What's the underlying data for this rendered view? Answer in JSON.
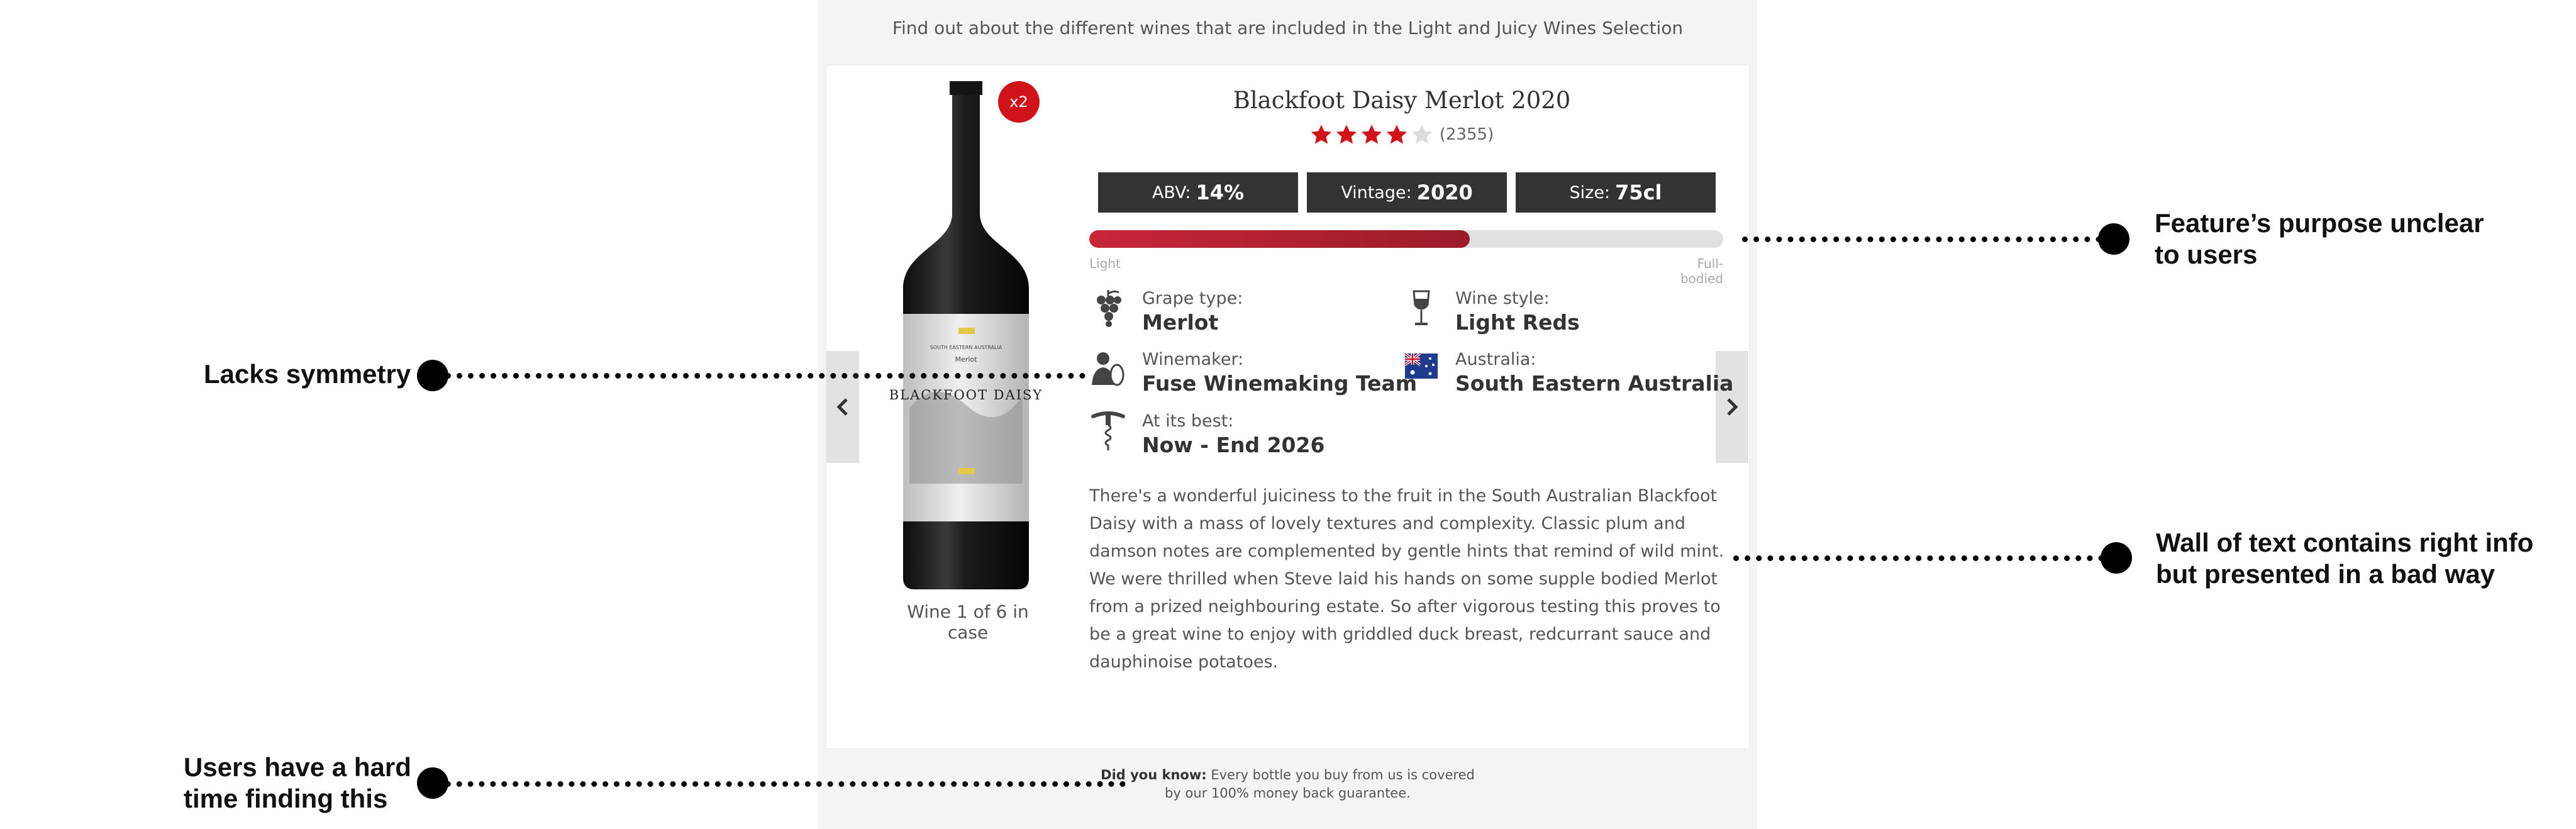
{
  "intro_text": "Find out about the different wines that are included in the Light and Juicy Wines Selection",
  "product": {
    "quantity_badge": "x2",
    "title": "Blackfoot Daisy Merlot 2020",
    "rating": 4,
    "rating_max": 5,
    "rating_count": "(2355)",
    "label_top": "SOUTH EASTERN AUSTRALIA",
    "label_variety": "Merlot",
    "label_brand": "BLACKFOOT DAISY",
    "chips": [
      {
        "key": "ABV:",
        "value": "14%"
      },
      {
        "key": "Vintage:",
        "value": "2020"
      },
      {
        "key": "Size:",
        "value": "75cl"
      }
    ],
    "body_scale": {
      "level": 0.6,
      "low_label": "Light",
      "high_label": "Full-bodied"
    },
    "attributes": {
      "grape": {
        "label": "Grape type:",
        "value": "Merlot",
        "icon": "grapes-icon"
      },
      "style": {
        "label": "Wine style:",
        "value": "Light Reds",
        "icon": "wine-glass-icon"
      },
      "winemaker": {
        "label": "Winemaker:",
        "value": "Fuse Winemaking Team",
        "icon": "winemaker-icon"
      },
      "region": {
        "label": "Australia:",
        "value": "South Eastern Australia",
        "icon": "australia-flag-icon"
      },
      "best": {
        "label": "At its best:",
        "value": "Now - End 2026",
        "icon": "corkscrew-icon"
      }
    },
    "description": "There's a wonderful juiciness to the fruit in the South Australian Blackfoot Daisy with a mass of lovely textures and complexity. Classic plum and damson notes are complemented by gentle hints that remind of wild mint. We were thrilled when Steve laid his hands on some supple bodied Merlot from a prized neighbouring estate. So after vigorous testing this proves to be a great wine to enjoy with griddled duck breast, redcurrant sauce and dauphinoise potatoes.",
    "case_position": "Wine 1 of 6 in case"
  },
  "footer": {
    "label": "Did you know:",
    "line1": "Every bottle you buy from us is covered",
    "line2": "by our 100% money back guarantee."
  },
  "annotations": [
    {
      "id": "feature",
      "line1": "Feature’s purpose unclear",
      "line2": "to users"
    },
    {
      "id": "symmetry",
      "line1": "Lacks symmetry",
      "line2": ""
    },
    {
      "id": "wall",
      "line1": "Wall of text contains right info",
      "line2": "but presented in a bad way"
    },
    {
      "id": "finding",
      "line1": "Users have a hard",
      "line2": "time finding this"
    }
  ],
  "colors": {
    "accent_red": "#d0121b",
    "chip_bg": "#333333",
    "bar_fill": "#b01f30"
  }
}
